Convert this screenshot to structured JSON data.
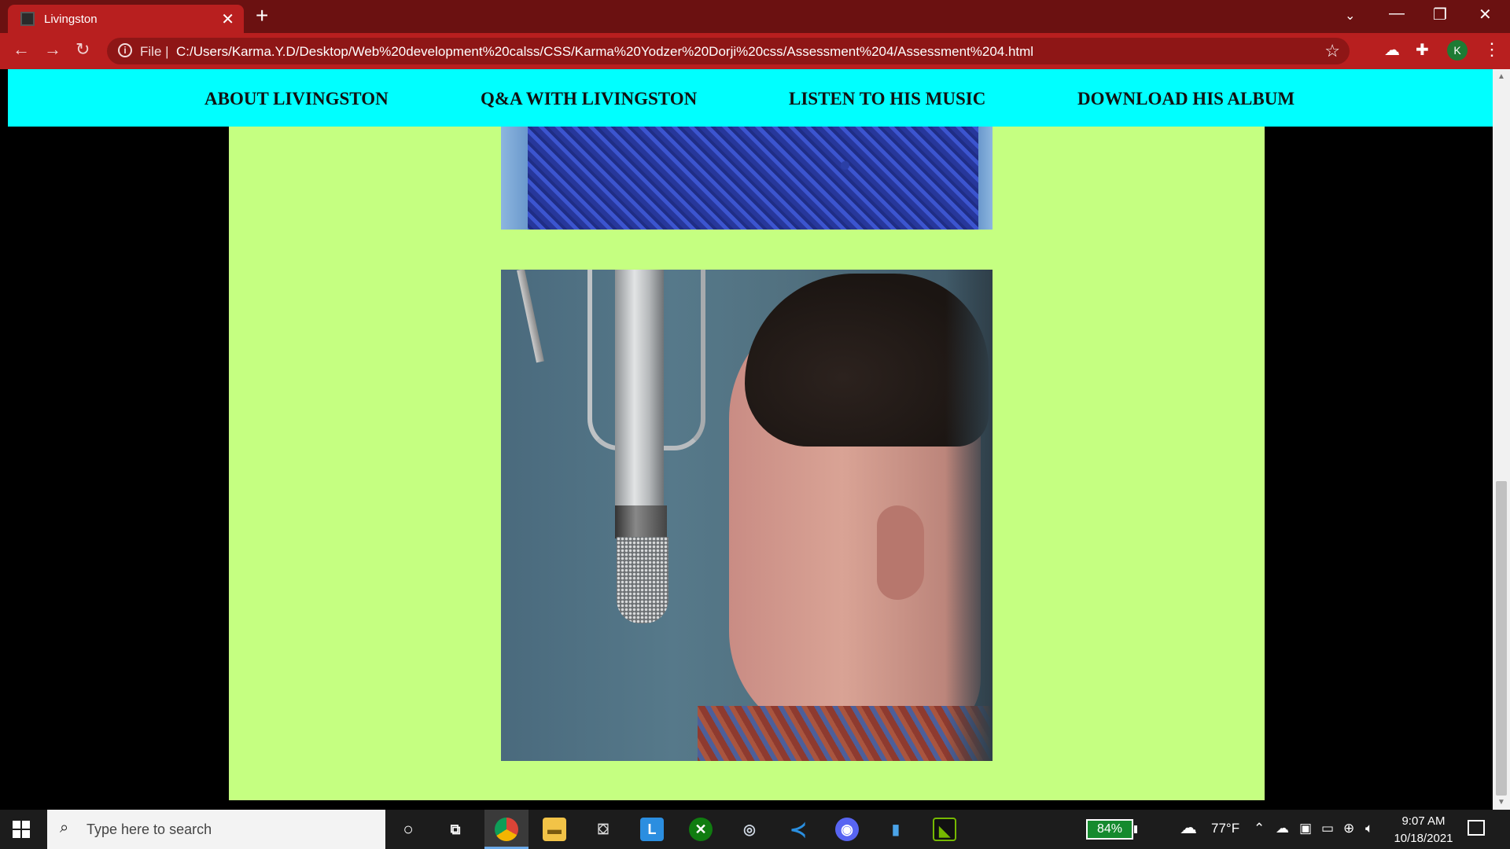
{
  "browser": {
    "tab_title": "Livingston",
    "tab_close": "✕",
    "new_tab": "+",
    "back": "←",
    "forward": "→",
    "reload": "↻",
    "info_icon": "i",
    "scheme_label": "File  |",
    "url": "C:/Users/Karma.Y.D/Desktop/Web%20development%20calss/CSS/Karma%20Yodzer%20Dorji%20css/Assessment%204/Assessment%204.html",
    "profile_initial": "K",
    "window_controls": {
      "dropdown": "⌄",
      "minimize": "—",
      "restore": "❐",
      "close": "✕"
    }
  },
  "page": {
    "nav": [
      "ABOUT LIVINGSTON",
      "Q&A WITH LIVINGSTON",
      "LISTEN TO HIS MUSIC",
      "DOWNLOAD HIS ALBUM"
    ],
    "colors": {
      "nav_bg": "#00ffff",
      "content_bg": "#c5ff81"
    }
  },
  "taskbar": {
    "search_placeholder": "Type here to search",
    "battery": "84%",
    "weather": "77°F",
    "time": "9:07 AM",
    "date": "10/18/2021",
    "icons": [
      "cortana-icon",
      "task-view-icon",
      "chrome-icon",
      "file-explorer-icon",
      "store-icon",
      "launcher-l-icon",
      "xbox-icon",
      "steam-icon",
      "vscode-icon",
      "discord-icon",
      "phone-app-icon",
      "nvidia-icon"
    ]
  }
}
